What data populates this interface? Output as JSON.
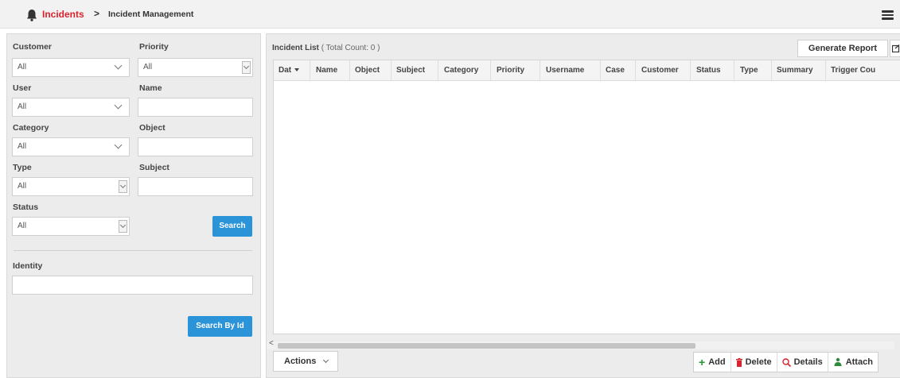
{
  "breadcrumb": {
    "home": "Incidents",
    "separator": ">",
    "current": "Incident Management"
  },
  "filters": {
    "customer": {
      "label": "Customer",
      "value": "All"
    },
    "priority": {
      "label": "Priority",
      "value": "All"
    },
    "user": {
      "label": "User",
      "value": "All"
    },
    "name": {
      "label": "Name",
      "value": ""
    },
    "category": {
      "label": "Category",
      "value": "All"
    },
    "object": {
      "label": "Object",
      "value": ""
    },
    "type": {
      "label": "Type",
      "value": "All"
    },
    "subject": {
      "label": "Subject",
      "value": ""
    },
    "status": {
      "label": "Status",
      "value": "All"
    },
    "search_button": "Search",
    "identity": {
      "label": "Identity",
      "value": ""
    },
    "search_by_id_button": "Search By Id"
  },
  "incident_list": {
    "title": "Incident List",
    "count_text": "( Total Count: 0 )",
    "generate_report": "Generate Report",
    "columns": [
      "Dat",
      "Name",
      "Object",
      "Subject",
      "Category",
      "Priority",
      "Username",
      "Case",
      "Customer",
      "Status",
      "Type",
      "Summary",
      "Trigger Cou"
    ],
    "rows": [],
    "actions_label": "Actions",
    "toolbar": {
      "add": "Add",
      "delete": "Delete",
      "details": "Details",
      "attach": "Attach"
    }
  },
  "icons": {
    "breadcrumb": "bell-icon",
    "menu": "hamburger-menu-icon",
    "add": "plus-icon",
    "delete": "trash-icon",
    "details": "magnifier-icon",
    "attach": "attach-icon"
  },
  "colors": {
    "accent": "#2b94d8",
    "breadcrumb_home": "#d9232d",
    "add_icon": "#1f9b2e"
  }
}
